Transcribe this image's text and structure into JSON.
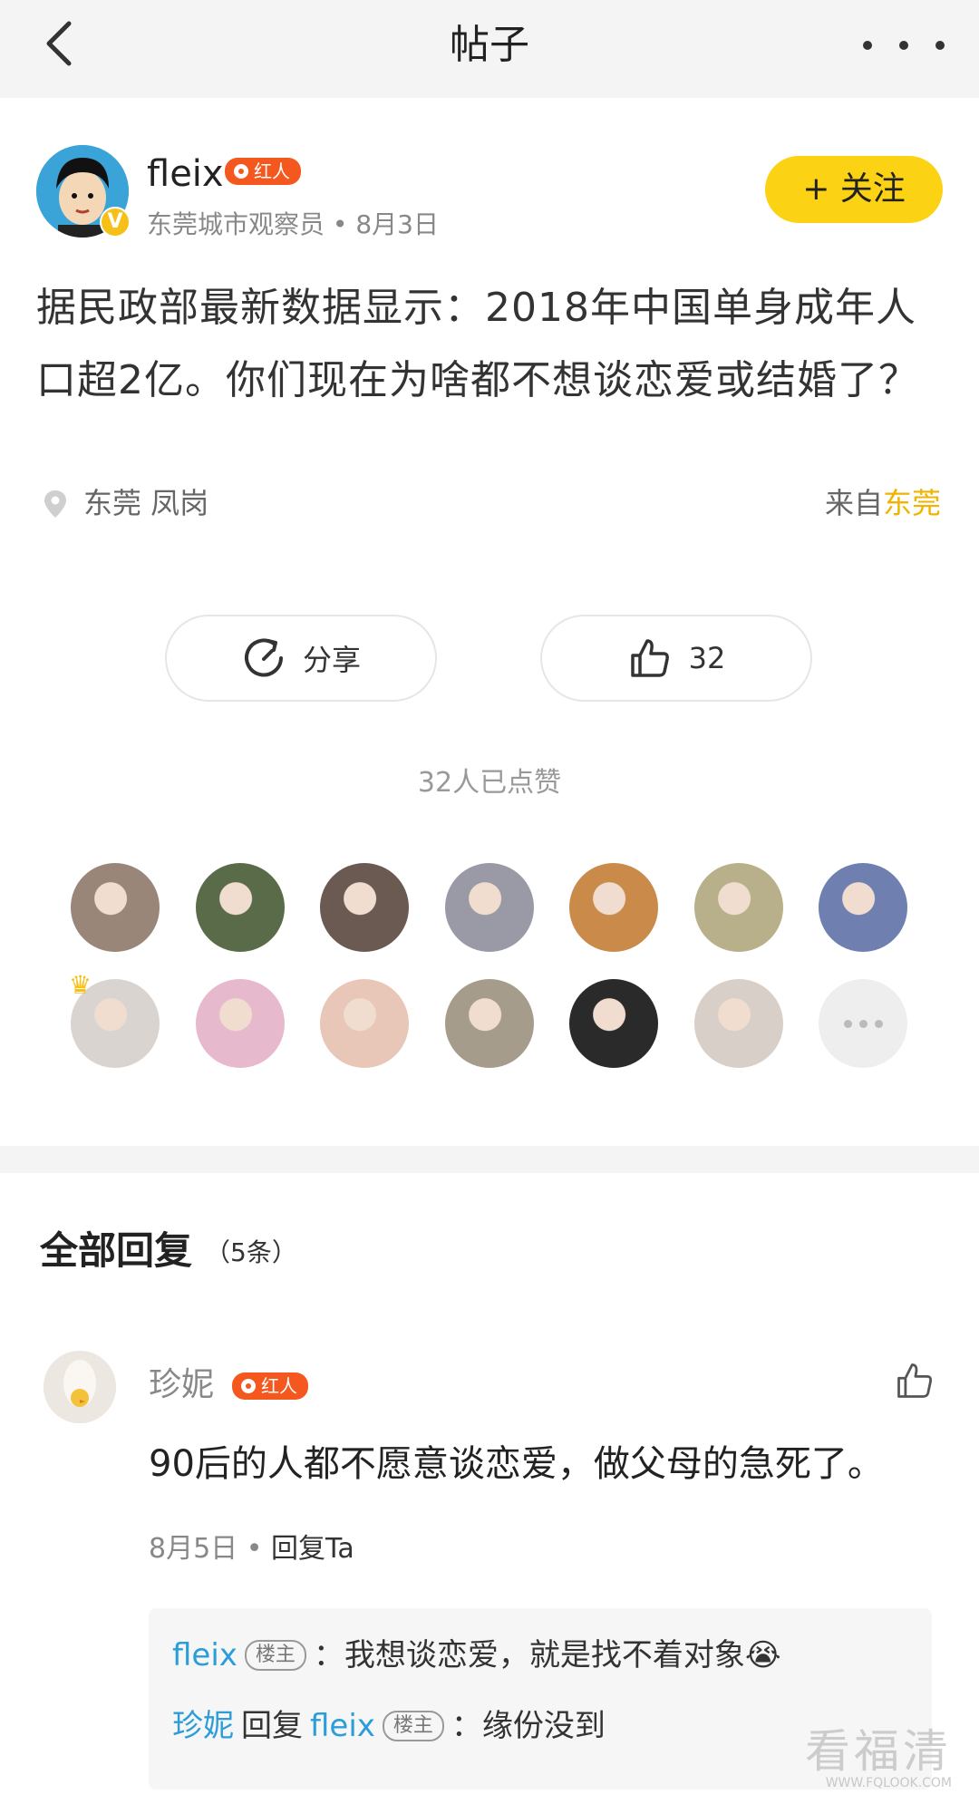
{
  "header": {
    "title": "帖子"
  },
  "author": {
    "name": "fleix",
    "badge": "红人",
    "verified_mark": "V",
    "meta": "东莞城市观察员 • 8月3日",
    "follow_label": "+ 关注"
  },
  "post": {
    "text": "据民政部最新数据显示：2018年中国单身成年人口超2亿。你们现在为啥都不想谈恋爱或结婚了？",
    "location": "东莞 凤岗",
    "source_prefix": "来自",
    "source_city": "东莞"
  },
  "actions": {
    "share_label": "分享",
    "like_count": "32"
  },
  "likes_summary": "32人已点赞",
  "likers": [
    {
      "color": "#9a8679"
    },
    {
      "color": "#5a6b4a"
    },
    {
      "color": "#6a5a52"
    },
    {
      "color": "#9a9aa6"
    },
    {
      "color": "#c98a4a"
    },
    {
      "color": "#b8b08a"
    },
    {
      "color": "#6f7fb0"
    },
    {
      "color": "#d9d4cf"
    },
    {
      "color": "#e7b9cc"
    },
    {
      "color": "#e9c7b8"
    },
    {
      "color": "#a59c8c"
    },
    {
      "color": "#2a2a2a"
    },
    {
      "color": "#d8cfc8"
    }
  ],
  "replies": {
    "title": "全部回复",
    "count": "（5条）",
    "items": [
      {
        "name": "珍妮",
        "badge": "红人",
        "text": "90后的人都不愿意谈恋爱，做父母的急死了。",
        "date": "8月5日",
        "reply_label": "回复Ta",
        "sub_replies": [
          {
            "name": "fleix",
            "tag": "楼主",
            "text": "：我想谈恋爱，就是找不着对象😭"
          },
          {
            "name": "珍妮",
            "mid": "回复",
            "target": "fleix",
            "tag": "楼主",
            "text": "：缘份没到"
          }
        ]
      }
    ]
  },
  "watermark": {
    "main": "看福清",
    "sub": "WWW.FQLOOK.COM"
  }
}
